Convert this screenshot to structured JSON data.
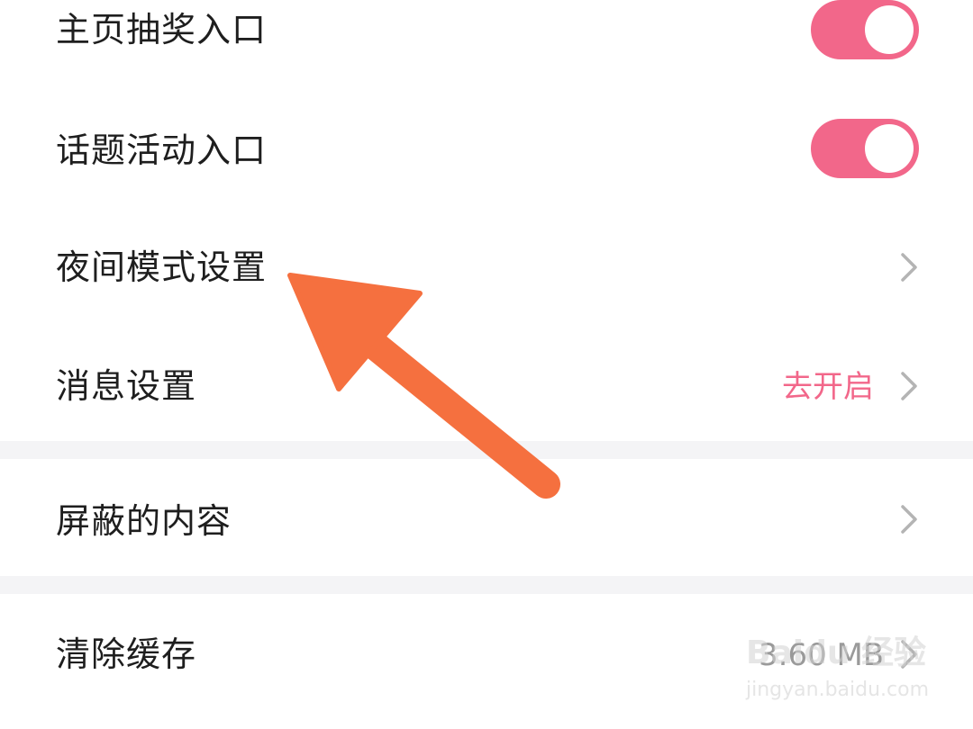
{
  "settings": {
    "rows": [
      {
        "label": "主页抽奖入口",
        "control": "toggle",
        "checked": true
      },
      {
        "label": "话题活动入口",
        "control": "toggle",
        "checked": true
      },
      {
        "label": "夜间模式设置",
        "control": "chevron"
      },
      {
        "label": "消息设置",
        "control": "chevron",
        "value": "去开启"
      },
      {
        "label": "屏蔽的内容",
        "control": "chevron"
      },
      {
        "label": "清除缓存",
        "control": "chevron",
        "value": "3.60 MB"
      }
    ]
  },
  "icons": {
    "chevron": "chevron-right-icon",
    "arrow": "arrow-annotation-icon"
  },
  "watermark": {
    "brand": "Baidu 经验",
    "url": "jingyan.baidu.com"
  },
  "colors": {
    "accent": "#f2678a",
    "annotation_arrow": "#f5703f",
    "section_gap": "#f4f4f6",
    "text_primary": "#1e1e1e",
    "chevron": "#b4b4b4"
  }
}
